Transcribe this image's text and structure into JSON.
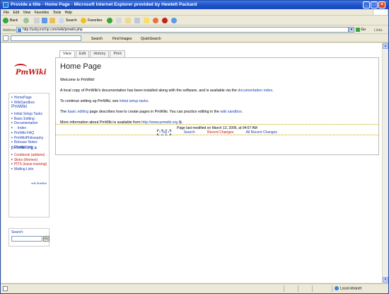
{
  "window": {
    "title": "Provide a title - Home Page - Microsoft Internet Explorer provided by Hewlett Packard",
    "buttons": {
      "minimize": "_",
      "maximize": "□",
      "close": "×"
    }
  },
  "menu": [
    "File",
    "Edit",
    "View",
    "Favorites",
    "Tools",
    "Help"
  ],
  "toolbar": {
    "back": "Back",
    "search": "Search",
    "favorites": "Favorites"
  },
  "address": {
    "label": "Address",
    "url": "http://usby.ind.hp.com/wiki/pmwiki.php",
    "go": "Go",
    "links": "Links"
  },
  "googlebar": {
    "search": "Search",
    "find_images": "Find Images",
    "quicksearch": "QuickSearch"
  },
  "page": {
    "logo": "PmWiki",
    "tabs": [
      "View",
      "Edit",
      "History",
      "Print"
    ],
    "title": "Home Page",
    "welcome": "Welcome to PmWiki!",
    "p1_pre": "A local copy of PmWiki's documentation has been installed along with the software, and is available via the",
    "p1_link": "documentation index",
    "p1_post": ".",
    "p2_pre": "To continue setting up PmWiki, see",
    "p2_link": "initial setup tasks",
    "p2_post": ".",
    "p3_pre": "The",
    "p3_link1": "basic editing",
    "p3_mid": "page describes how to create pages in PmWiki. You can practice editing in the",
    "p3_link2": "wiki sandbox",
    "p3_post": ".",
    "p4_pre": "More information about PmWiki is available from",
    "p4_link": "http://www.pmwiki.org",
    "p4_post": "."
  },
  "footer": {
    "modified": "Page last modified on March 13, 2006, at 04:07 AM",
    "top": "• Top •",
    "search": "Search",
    "recent": "Recent Changes",
    "all_recent": "All Recent Changes"
  },
  "sidebar": {
    "group1": [
      "HomePage",
      "WikiSandbox"
    ],
    "heading1": "PmWiki",
    "group2": [
      "Initial Setup Tasks",
      "Basic Editing",
      "Documentation",
      "Index",
      "PmWiki FAQ",
      "PmWikiPhilosophy",
      "Release Notes",
      "ChangeLog"
    ],
    "heading2": "pmwiki.org",
    "group3": [
      "Cookbook (addons)",
      "Skins (themes)",
      "PITS (issue tracking)",
      "Mailing Lists"
    ],
    "edit_sidebar": "edit SideBar"
  },
  "search_box": {
    "label": "Search:",
    "go": "Go"
  },
  "status": {
    "zone": "Local intranet"
  }
}
